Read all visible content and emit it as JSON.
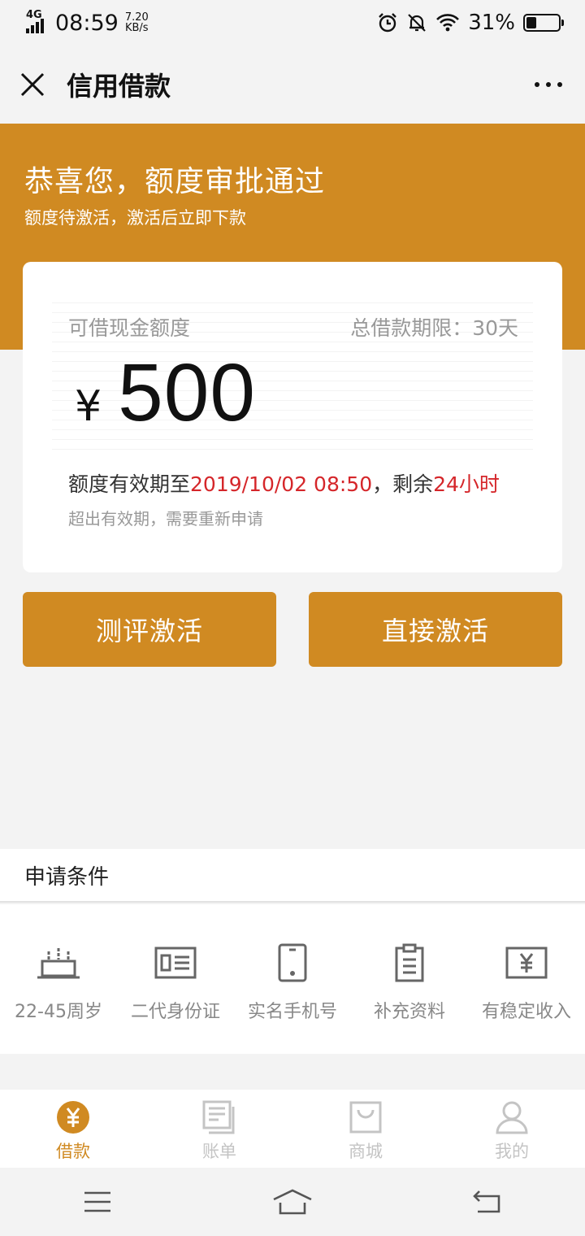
{
  "status_bar": {
    "network": "4G",
    "time": "08:59",
    "speed_value": "7.20",
    "speed_unit": "KB/s",
    "battery_text": "31%",
    "battery_level": 0.31
  },
  "nav": {
    "title": "信用借款"
  },
  "banner": {
    "title": "恭喜您，额度审批通过",
    "subtitle": "额度待激活，激活后立即下款",
    "color": "#d08a22"
  },
  "card": {
    "label": "可借现金额度",
    "term": "总借款期限：30天",
    "currency": "¥",
    "amount": "500",
    "valid_prefix": "额度有效期至",
    "valid_date": "2019/10/02 08:50",
    "valid_mid": "，剩余",
    "valid_remaining": "24小时",
    "note": "超出有效期，需要重新申请",
    "highlight_color": "#d5262a"
  },
  "buttons": {
    "evaluate_label": "测评激活",
    "direct_label": "直接激活"
  },
  "conditions": {
    "title": "申请条件",
    "items": [
      {
        "label": "22-45周岁",
        "icon": "cake-icon"
      },
      {
        "label": "二代身份证",
        "icon": "id-card-icon"
      },
      {
        "label": "实名手机号",
        "icon": "phone-icon"
      },
      {
        "label": "补充资料",
        "icon": "clipboard-icon"
      },
      {
        "label": "有稳定收入",
        "icon": "banknote-icon"
      }
    ]
  },
  "tabs": [
    {
      "label": "借款",
      "icon": "yuan-coin-icon",
      "active": true
    },
    {
      "label": "账单",
      "icon": "bill-icon",
      "active": false
    },
    {
      "label": "商城",
      "icon": "shopping-bag-icon",
      "active": false
    },
    {
      "label": "我的",
      "icon": "user-icon",
      "active": false
    }
  ]
}
